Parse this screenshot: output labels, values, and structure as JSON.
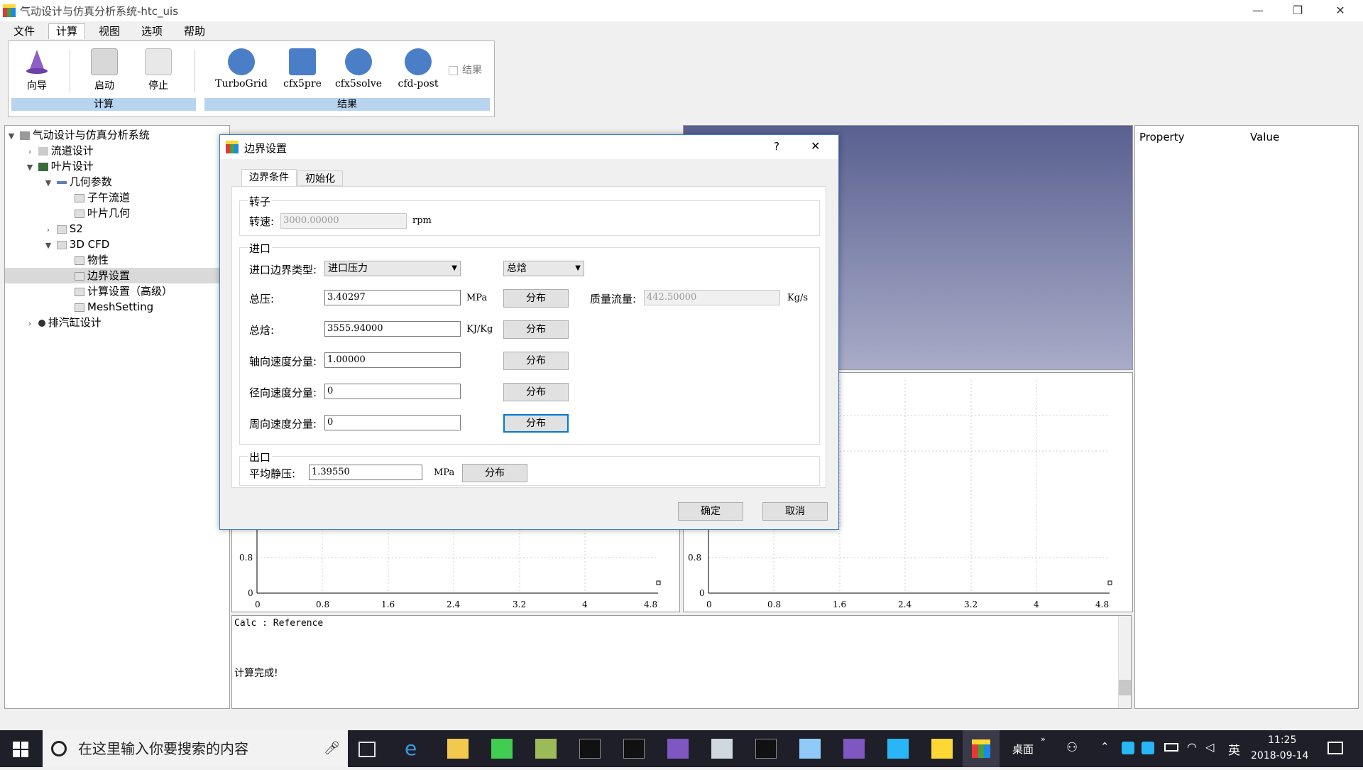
{
  "window": {
    "title": "气动设计与仿真分析系统-htc_uis",
    "minimize": "—",
    "restore": "❐",
    "close": "✕"
  },
  "menu": [
    {
      "label": "文件"
    },
    {
      "label": "计算",
      "active": true
    },
    {
      "label": "视图"
    },
    {
      "label": "选项"
    },
    {
      "label": "帮助"
    }
  ],
  "ribbon": {
    "btn_wizard": "向导",
    "btn_start": "启动",
    "btn_stop": "停止",
    "btn_turbogrid": "TurboGrid",
    "btn_cfx5pre": "cfx5pre",
    "btn_cfx5solve": "cfx5solve",
    "btn_cfdpost": "cfd-post",
    "check_result": "结果",
    "group_calc": "计算",
    "group_result": "结果"
  },
  "tree": {
    "root": "气动设计与仿真分析系统",
    "flow": "流道设计",
    "blade": "叶片设计",
    "geom": "几何参数",
    "meridional": "子午流道",
    "bladegeom": "叶片几何",
    "s2": "S2",
    "cfd3d": "3D CFD",
    "props": "物性",
    "boundary": "边界设置",
    "calcadv": "计算设置（高级）",
    "mesh": "MeshSetting",
    "exhaust": "排汽缸设计"
  },
  "property": {
    "col1": "Property",
    "col2": "Value"
  },
  "plots": {
    "yticks": [
      "0.8",
      "0"
    ],
    "xticks": [
      "0",
      "0.8",
      "1.6",
      "2.4",
      "3.2",
      "4",
      "4.8"
    ]
  },
  "console": {
    "line1": "Calc : Reference",
    "line2": "计算完成!"
  },
  "dialog": {
    "title": "边界设置",
    "help": "?",
    "close": "✕",
    "tab_bc": "边界条件",
    "tab_init": "初始化",
    "rotor": {
      "title": "转子",
      "speed_label": "转速:",
      "speed_value": "3000.00000",
      "speed_unit": "rpm"
    },
    "inlet": {
      "title": "进口",
      "type_label": "进口边界类型:",
      "type_value": "进口压力",
      "mode_value": "总焓",
      "p_label": "总压:",
      "p_value": "3.40297",
      "p_unit": "MPa",
      "mass_label": "质量流量:",
      "mass_value": "442.50000",
      "mass_unit": "Kg/s",
      "h_label": "总焓:",
      "h_value": "3555.94000",
      "h_unit": "KJ/Kg",
      "ax_label": "轴向速度分量:",
      "ax_value": "1.00000",
      "rad_label": "径向速度分量:",
      "rad_value": "0",
      "cir_label": "周向速度分量:",
      "cir_value": "0",
      "dist": "分布"
    },
    "outlet": {
      "title": "出口",
      "p_label": "平均静压:",
      "p_value": "1.39550",
      "p_unit": "MPa",
      "dist": "分布"
    },
    "ok": "确定",
    "cancel": "取消"
  },
  "taskbar": {
    "search_placeholder": "在这里输入你要搜索的内容",
    "desktop": "桌面",
    "ime": "英",
    "time": "11:25",
    "date": "2018-09-14"
  }
}
